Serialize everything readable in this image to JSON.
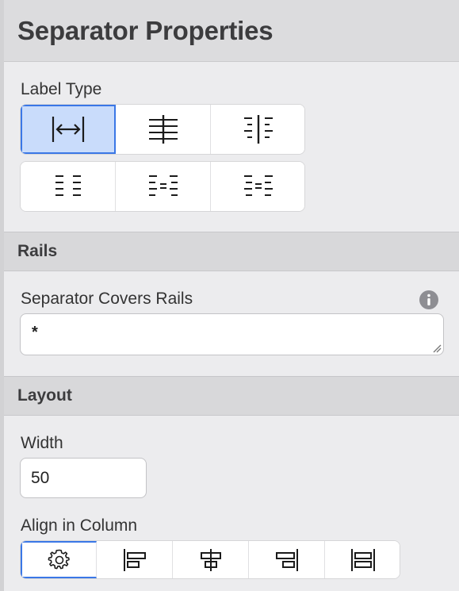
{
  "panel": {
    "title": "Separator Properties"
  },
  "label_type": {
    "label": "Label Type",
    "options": [
      {
        "icon": "arrow-between-bars-icon",
        "selected": true
      },
      {
        "icon": "center-line-icon",
        "selected": false
      },
      {
        "icon": "split-columns-icon",
        "selected": false
      },
      {
        "icon": "two-columns-icon",
        "selected": false
      },
      {
        "icon": "columns-equal-icon",
        "selected": false
      },
      {
        "icon": "columns-equal-alt-icon",
        "selected": false
      }
    ]
  },
  "rails": {
    "section_title": "Rails",
    "covers_label": "Separator Covers Rails",
    "covers_value": "*"
  },
  "layout": {
    "section_title": "Layout",
    "width_label": "Width",
    "width_value": "50",
    "align_label": "Align in Column",
    "align_options": [
      {
        "icon": "gear-icon",
        "selected": true
      },
      {
        "icon": "align-left-icon",
        "selected": false
      },
      {
        "icon": "align-center-icon",
        "selected": false
      },
      {
        "icon": "align-right-icon",
        "selected": false
      },
      {
        "icon": "align-stretch-icon",
        "selected": false
      }
    ]
  },
  "colors": {
    "selected_fill": "#c9dcfb",
    "selected_border": "#3a77e6"
  }
}
